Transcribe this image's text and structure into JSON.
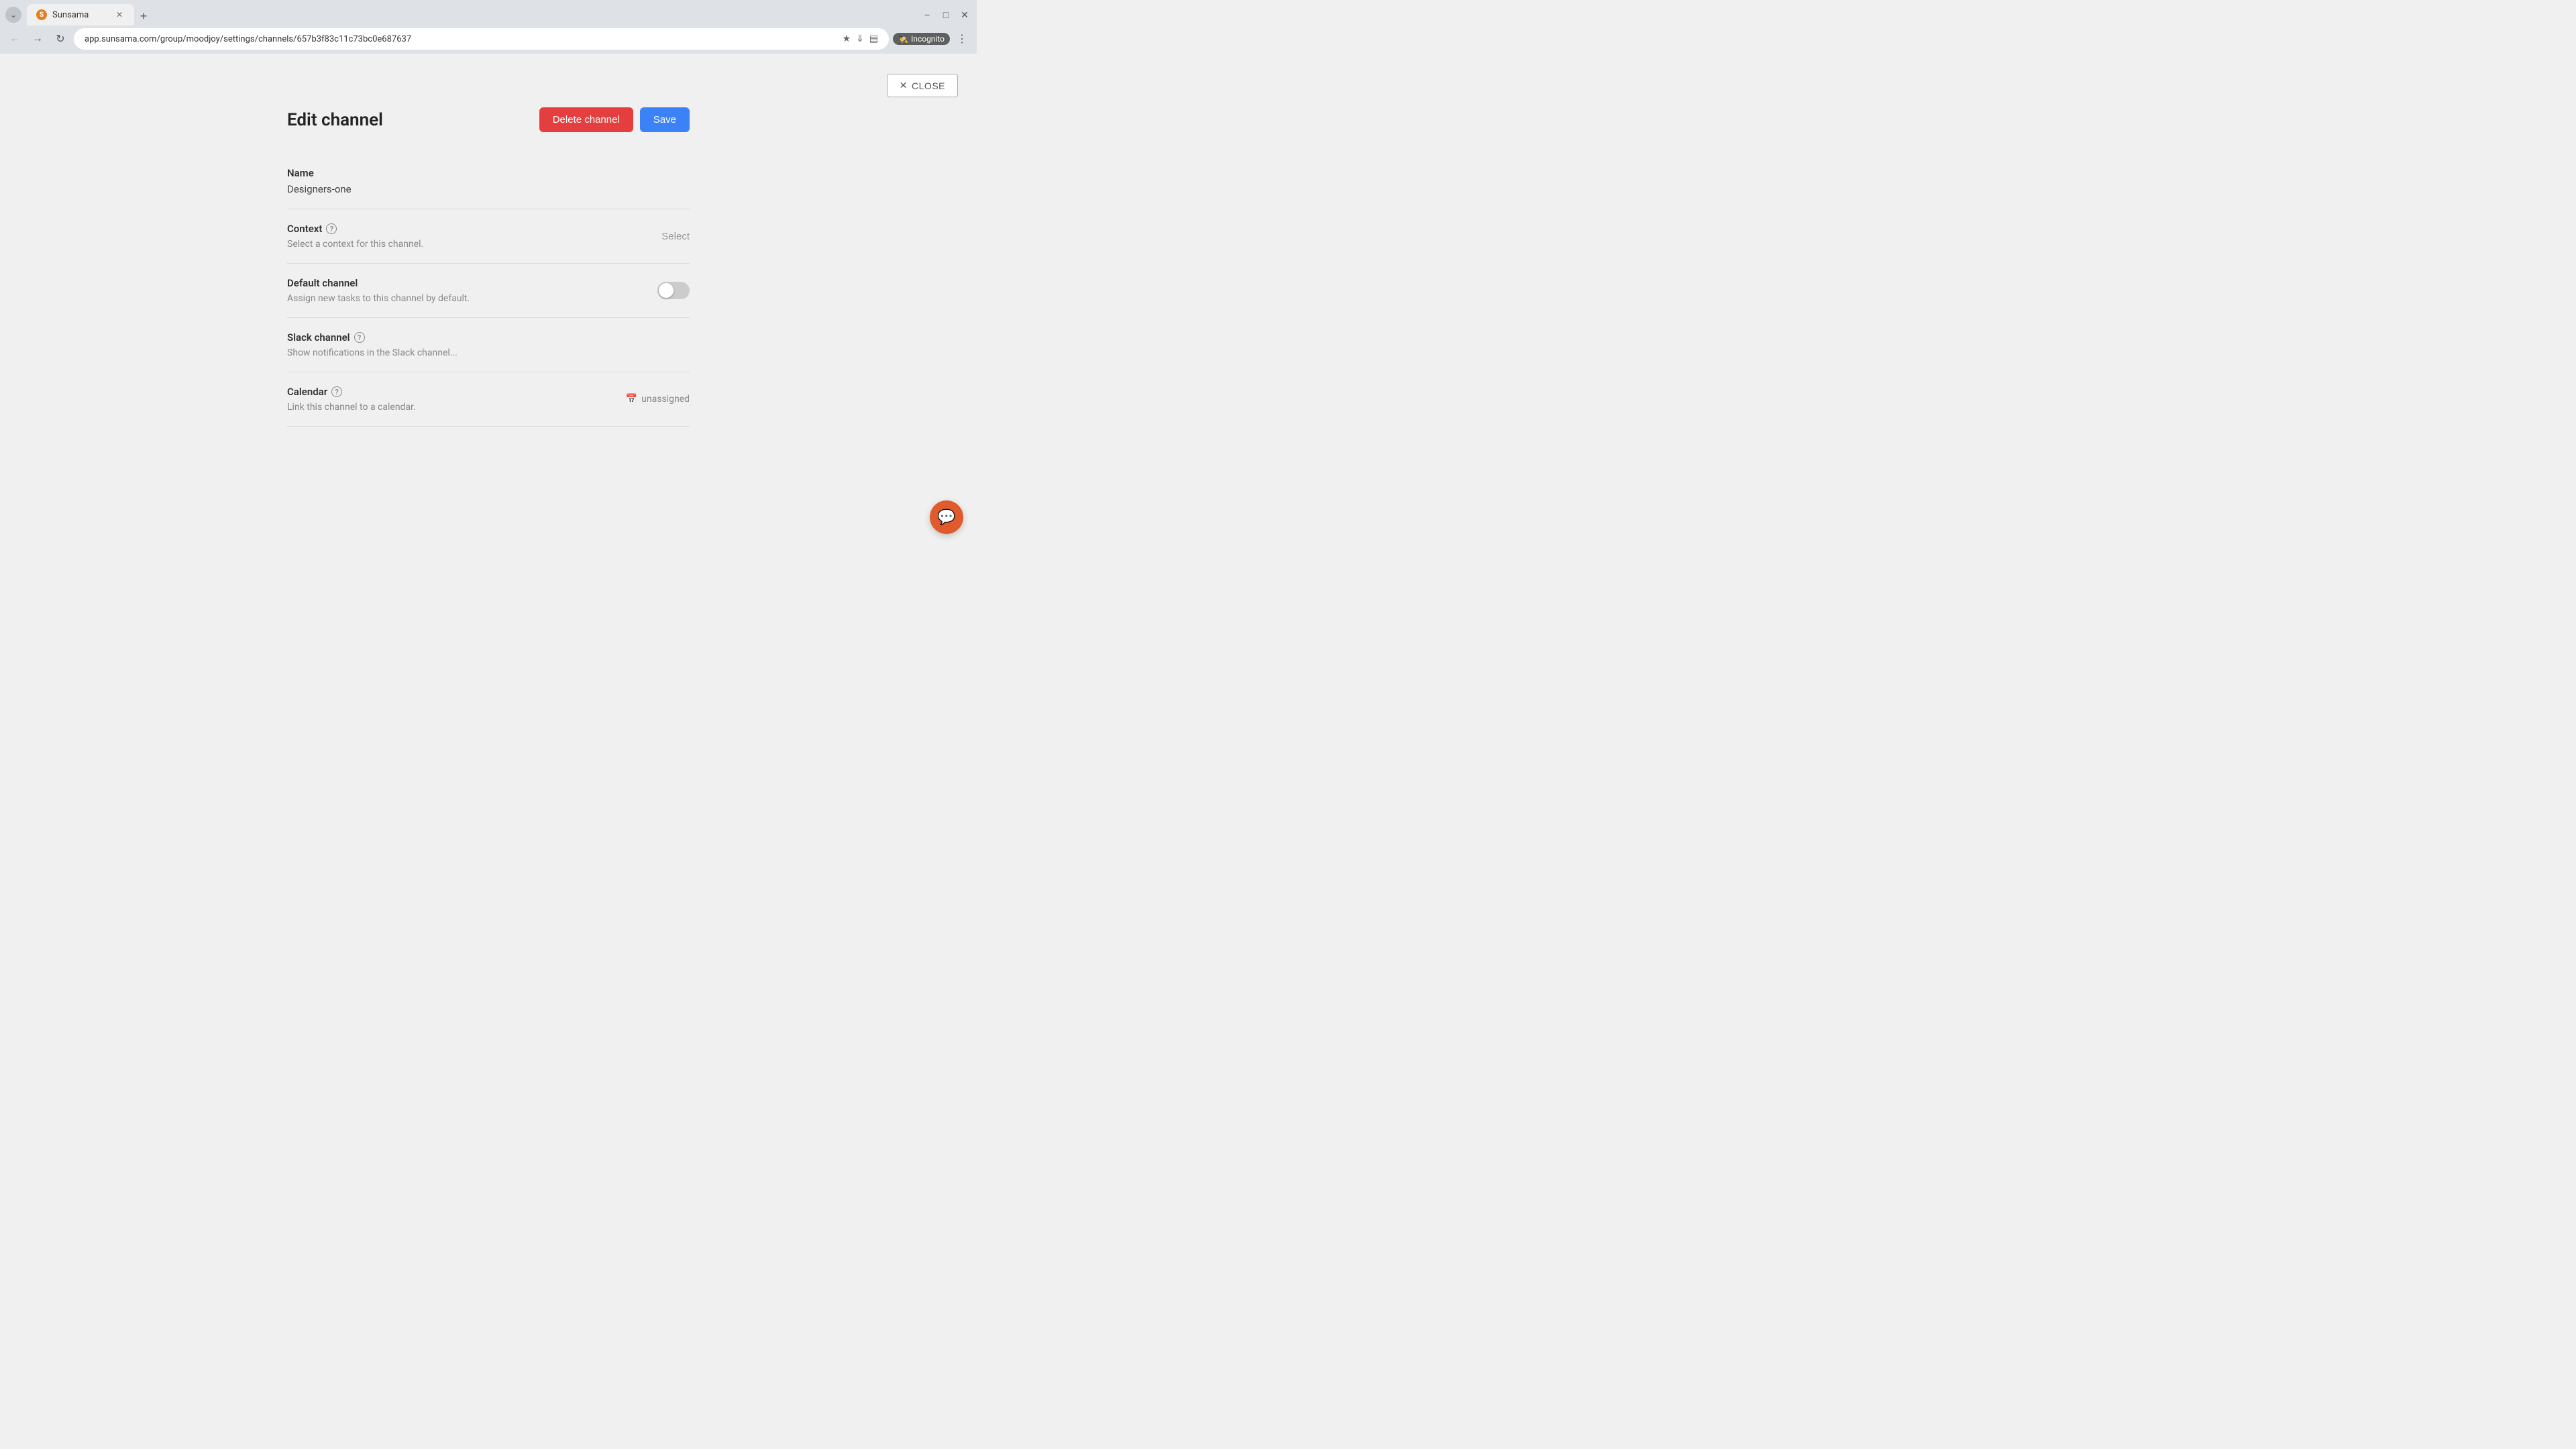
{
  "browser": {
    "tab": {
      "favicon_label": "S",
      "title": "Sunsama"
    },
    "url": "app.sunsama.com/group/moodjoy/settings/channels/657b3f83c11c73bc0e687637",
    "incognito_label": "Incognito"
  },
  "close_button": {
    "label": "CLOSE",
    "icon": "×"
  },
  "form": {
    "title": "Edit channel",
    "delete_button": "Delete channel",
    "save_button": "Save",
    "fields": {
      "name": {
        "label": "Name",
        "value": "Designers-one"
      },
      "context": {
        "label": "Context",
        "help": "?",
        "description": "Select a context for this channel.",
        "select_placeholder": "Select"
      },
      "default_channel": {
        "label": "Default channel",
        "description": "Assign new tasks to this channel by default.",
        "toggle_state": "off"
      },
      "slack_channel": {
        "label": "Slack channel",
        "help": "?",
        "placeholder": "Show notifications in the Slack channel..."
      },
      "calendar": {
        "label": "Calendar",
        "help": "?",
        "description": "Link this channel to a calendar.",
        "value": "unassigned"
      }
    }
  }
}
